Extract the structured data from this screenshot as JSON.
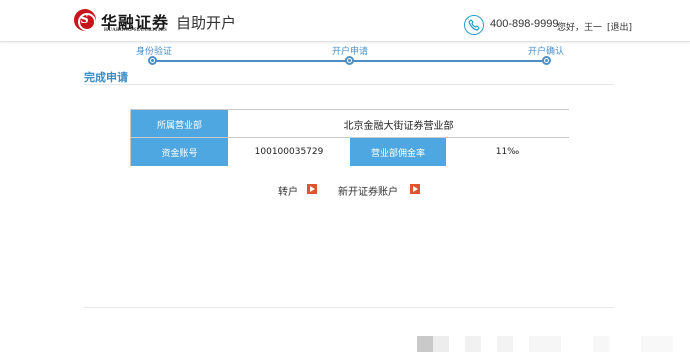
{
  "header": {
    "brand_cn": "华融证券",
    "brand_en": "HUARONG SECURITIES",
    "page_title": "自助开户",
    "hotline": "400-898-9999",
    "greeting": "您好，王一",
    "logout": "[退出]"
  },
  "steps": [
    {
      "label": "身份验证"
    },
    {
      "label": "开户申请"
    },
    {
      "label": "开户确认"
    }
  ],
  "section_title": "完成申请",
  "info": {
    "branch_label": "所属营业部",
    "branch_value": "北京金融大街证券营业部",
    "account_label": "资金账号",
    "account_value": "100100035729",
    "commission_label": "营业部佣金率",
    "commission_value": "11‰"
  },
  "links": {
    "transfer": "转户",
    "new_account": "新开证券账户"
  },
  "colors": {
    "accent_blue": "#4ea7e0",
    "step_blue": "#4d8fc4",
    "arrow_red": "#e0532f",
    "logo_red": "#c8151d"
  }
}
